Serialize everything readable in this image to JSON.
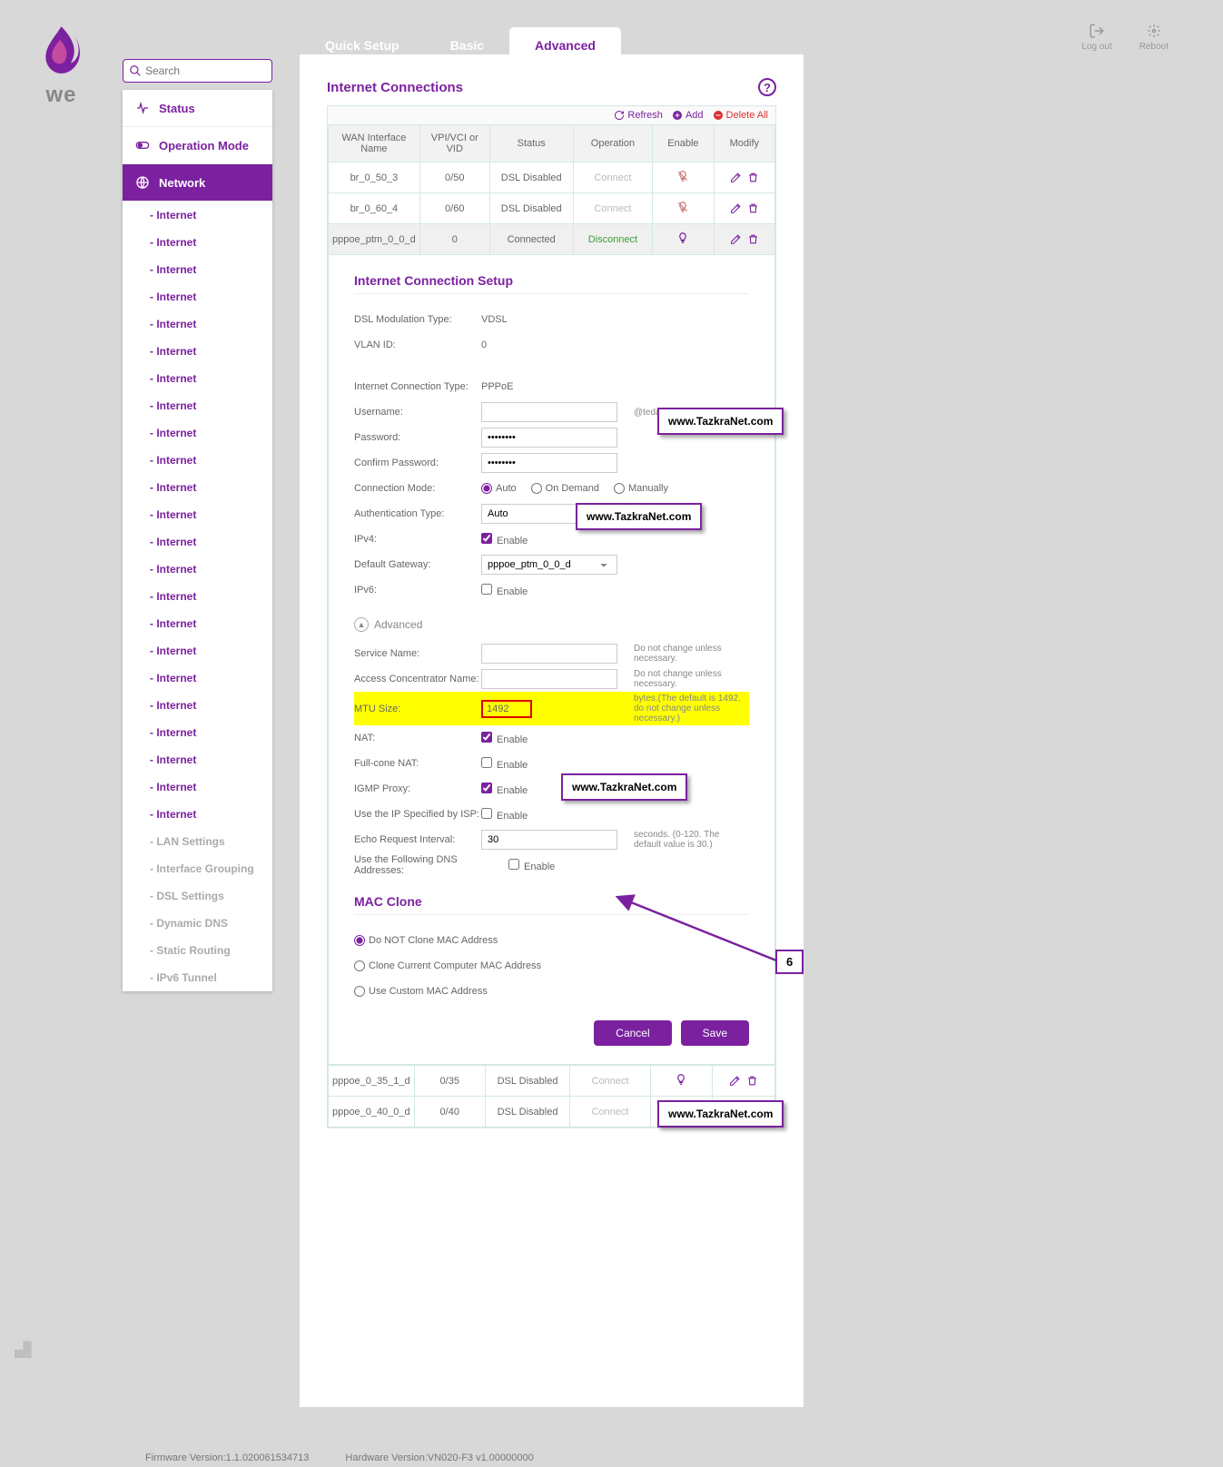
{
  "top_right": {
    "logout": "Log out",
    "reboot": "Reboot"
  },
  "brand": "we",
  "tabs": {
    "quick": "Quick Setup",
    "basic": "Basic",
    "advanced": "Advanced"
  },
  "search_placeholder": "Search",
  "sidebar": {
    "status": "Status",
    "op": "Operation Mode",
    "network": "Network",
    "subs": [
      "- Internet",
      "- Internet",
      "- Internet",
      "- Internet",
      "- Internet",
      "- Internet",
      "- Internet",
      "- Internet",
      "- Internet",
      "- Internet",
      "- Internet",
      "- Internet",
      "- Internet",
      "- Internet",
      "- Internet",
      "- Internet",
      "- Internet",
      "- Internet",
      "- Internet",
      "- Internet",
      "- Internet",
      "- Internet",
      "- Internet",
      "- LAN Settings",
      "- Interface Grouping",
      "- DSL Settings",
      "- Dynamic DNS",
      "- Static Routing",
      "- IPv6 Tunnel"
    ]
  },
  "panel": {
    "title": "Internet Connections"
  },
  "tbl_actions": {
    "refresh": "Refresh",
    "add": "Add",
    "delete": "Delete All"
  },
  "tbl_head": {
    "c0": "WAN Interface Name",
    "c1": "VPI/VCI or VID",
    "c2": "Status",
    "c3": "Operation",
    "c4": "Enable",
    "c5": "Modify"
  },
  "rows_top": [
    {
      "n": "br_0_50_3",
      "v": "0/50",
      "s": "DSL Disabled",
      "op": "Connect",
      "en": false
    },
    {
      "n": "br_0_60_4",
      "v": "0/60",
      "s": "DSL Disabled",
      "op": "Connect",
      "en": false
    }
  ],
  "row_sel": {
    "n": "pppoe_ptm_0_0_d",
    "v": "0",
    "s": "Connected",
    "op": "Disconnect",
    "en": true
  },
  "rows_bottom": [
    {
      "n": "pppoe_0_35_1_d",
      "v": "0/35",
      "s": "DSL Disabled",
      "op": "Connect",
      "en": true
    },
    {
      "n": "pppoe_0_40_0_d",
      "v": "0/40",
      "s": "DSL Disabled",
      "op": "Connect",
      "en": false
    }
  ],
  "setup": {
    "title": "Internet Connection Setup",
    "dsl_mod_l": "DSL Modulation Type:",
    "dsl_mod_v": "VDSL",
    "vlan_l": "VLAN ID:",
    "vlan_v": "0",
    "conn_type_l": "Internet Connection Type:",
    "conn_type_v": "PPPoE",
    "user_l": "Username:",
    "user_suffix": "@tedata.net.eg",
    "pass_l": "Password:",
    "pass_v": "********",
    "cpass_l": "Confirm Password:",
    "cpass_v": "********",
    "connmode_l": "Connection Mode:",
    "connmode_opts": {
      "a": "Auto",
      "b": "On Demand",
      "c": "Manually"
    },
    "auth_l": "Authentication Type:",
    "auth_v": "Auto",
    "ipv4_l": "IPv4:",
    "enable": "Enable",
    "gw_l": "Default Gateway:",
    "gw_v": "pppoe_ptm_0_0_d",
    "ipv6_l": "IPv6:",
    "adv_toggle": "Advanced",
    "svc_l": "Service Name:",
    "svc_hint": "Do not change unless necessary.",
    "ac_l": "Access Concentrator Name:",
    "ac_hint": "Do not change unless necessary.",
    "mtu_l": "MTU Size:",
    "mtu_v": "1492",
    "mtu_hint": "bytes.(The default is 1492, do not change unless necessary.)",
    "nat_l": "NAT:",
    "fcnat_l": "Full-cone NAT:",
    "igmp_l": "IGMP Proxy:",
    "ipisp_l": "Use the IP Specified by ISP:",
    "echo_l": "Echo Request Interval:",
    "echo_v": "30",
    "echo_hint": "seconds. (0-120. The default value is 30.)",
    "dns_l": "Use the Following DNS Addresses:",
    "mac_title": "MAC Clone",
    "mac_opts": {
      "a": "Do NOT Clone MAC Address",
      "b": "Clone Current Computer MAC Address",
      "c": "Use Custom MAC Address"
    },
    "cancel": "Cancel",
    "save": "Save"
  },
  "watermark": "www.TazkraNet.com",
  "callout": "6",
  "footer": {
    "fw": "Firmware Version:1.1.020061534713",
    "hw": "Hardware Version:VN020-F3 v1.00000000"
  }
}
